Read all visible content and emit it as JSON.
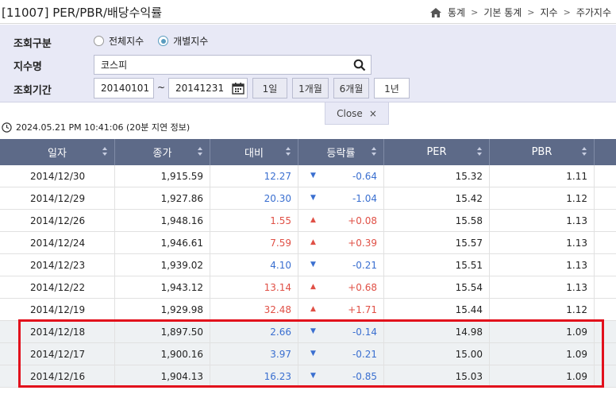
{
  "header": {
    "title": "[11007] PER/PBR/배당수익률",
    "breadcrumb": [
      "통계",
      "기본 통계",
      "지수",
      "주가지수"
    ]
  },
  "search": {
    "type_label": "조회구분",
    "type_options": [
      "전체지수",
      "개별지수"
    ],
    "type_selected": "개별지수",
    "name_label": "지수명",
    "name_value": "코스피",
    "period_label": "조회기간",
    "start_date": "20140101",
    "tilde": "~",
    "end_date": "20141231",
    "period_buttons": [
      "1일",
      "1개월",
      "6개월",
      "1년"
    ],
    "close_label": "Close",
    "close_x": "×"
  },
  "timestamp": "2024.05.21 PM 10:41:06 (20분 지연 정보)",
  "table": {
    "columns": [
      "일자",
      "종가",
      "대비",
      "등락률",
      "PER",
      "PBR"
    ],
    "rows": [
      {
        "date": "2014/12/30",
        "close": "1,915.59",
        "dir": "down",
        "change": "12.27",
        "rate": "-0.64",
        "per": "15.32",
        "pbr": "1.11"
      },
      {
        "date": "2014/12/29",
        "close": "1,927.86",
        "dir": "down",
        "change": "20.30",
        "rate": "-1.04",
        "per": "15.42",
        "pbr": "1.12"
      },
      {
        "date": "2014/12/26",
        "close": "1,948.16",
        "dir": "up",
        "change": "1.55",
        "rate": "+0.08",
        "per": "15.58",
        "pbr": "1.13"
      },
      {
        "date": "2014/12/24",
        "close": "1,946.61",
        "dir": "up",
        "change": "7.59",
        "rate": "+0.39",
        "per": "15.57",
        "pbr": "1.13"
      },
      {
        "date": "2014/12/23",
        "close": "1,939.02",
        "dir": "down",
        "change": "4.10",
        "rate": "-0.21",
        "per": "15.51",
        "pbr": "1.13"
      },
      {
        "date": "2014/12/22",
        "close": "1,943.12",
        "dir": "up",
        "change": "13.14",
        "rate": "+0.68",
        "per": "15.54",
        "pbr": "1.13"
      },
      {
        "date": "2014/12/19",
        "close": "1,929.98",
        "dir": "up",
        "change": "32.48",
        "rate": "+1.71",
        "per": "15.44",
        "pbr": "1.12"
      },
      {
        "date": "2014/12/18",
        "close": "1,897.50",
        "dir": "down",
        "change": "2.66",
        "rate": "-0.14",
        "per": "14.98",
        "pbr": "1.09"
      },
      {
        "date": "2014/12/17",
        "close": "1,900.16",
        "dir": "down",
        "change": "3.97",
        "rate": "-0.21",
        "per": "15.00",
        "pbr": "1.09"
      },
      {
        "date": "2014/12/16",
        "close": "1,904.13",
        "dir": "down",
        "change": "16.23",
        "rate": "-0.85",
        "per": "15.03",
        "pbr": "1.09"
      }
    ],
    "highlighted_rows": [
      "2014/12/18",
      "2014/12/17",
      "2014/12/16"
    ]
  },
  "colors": {
    "up": "#e05046",
    "down": "#3a6fd0",
    "header_bg": "#5d6a88",
    "highlight_border": "#e2101c"
  },
  "icons": {
    "home": "home-icon",
    "search": "search-icon",
    "calendar": "calendar-icon",
    "clock": "clock-icon",
    "close": "close-icon"
  }
}
